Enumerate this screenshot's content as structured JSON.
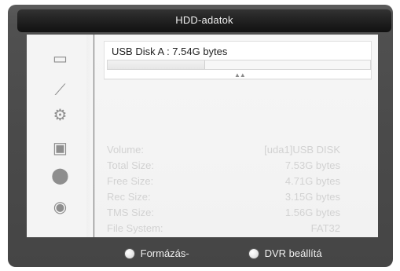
{
  "window": {
    "title": "HDD-adatok"
  },
  "sidebar": {
    "icons": [
      {
        "icon": "monitor-icon",
        "glyph": "▭"
      },
      {
        "icon": "satellite-dish-icon",
        "glyph": "⟋"
      },
      {
        "icon": "settings-gear-icon",
        "glyph": "⚙"
      },
      {
        "icon": "toolbox-icon",
        "glyph": "▣"
      },
      {
        "icon": "game-icon",
        "glyph": "⬤"
      },
      {
        "icon": "media-player-icon",
        "glyph": "◉"
      }
    ]
  },
  "disk": {
    "label": "USB Disk A : 7.54G bytes",
    "usage_fraction": 0.37,
    "markers": "▲▲"
  },
  "info": {
    "volume_label": "Volume:",
    "volume_value": "[uda1]USB DISK",
    "total_size_label": "Total Size:",
    "total_size_value": "7.53G bytes",
    "free_size_label": "Free Size:",
    "free_size_value": "4.71G bytes",
    "rec_size_label": "Rec Size:",
    "rec_size_value": "3.15G bytes",
    "tms_size_label": "TMS Size:",
    "tms_size_value": "1.56G bytes",
    "file_system_label": "File System:",
    "file_system_value": "FAT32"
  },
  "footer": {
    "format_label": "Formázás-",
    "dvr_settings_label": "DVR beállítá"
  },
  "colors": {
    "accent": "#f2f2f2",
    "panel_text": "#d2d2d2",
    "title_text": "#efefef"
  }
}
